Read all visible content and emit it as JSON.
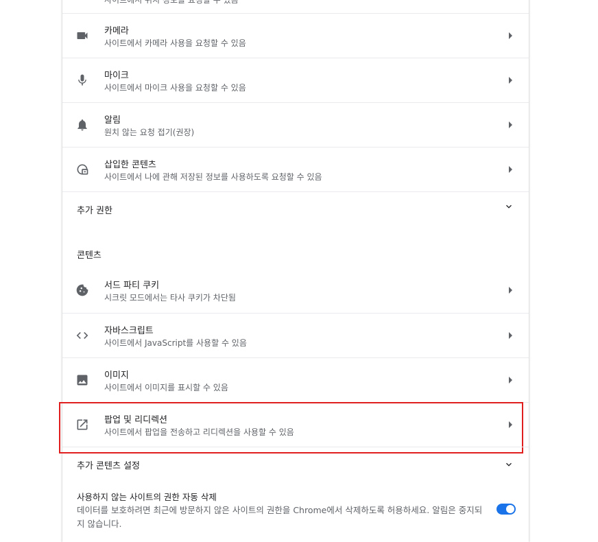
{
  "top_partial_text": "사이트에서 위치 정보를 요청할 수 있음",
  "permissions": [
    {
      "title": "카메라",
      "sub": "사이트에서 카메라 사용을 요청할 수 있음",
      "icon": "camera-icon"
    },
    {
      "title": "마이크",
      "sub": "사이트에서 마이크 사용을 요청할 수 있음",
      "icon": "microphone-icon"
    },
    {
      "title": "알림",
      "sub": "원치 않는 요청 접기(권장)",
      "icon": "bell-icon"
    },
    {
      "title": "삽입한 콘텐츠",
      "sub": "사이트에서 나에 관해 저장된 정보를 사용하도록 요청할 수 있음",
      "icon": "embedded-content-icon"
    }
  ],
  "additional_permissions_label": "추가 권한",
  "content_section_label": "콘텐츠",
  "content": [
    {
      "title": "서드 파티 쿠키",
      "sub": "시크릿 모드에서는 타사 쿠키가 차단됨",
      "icon": "cookie-icon"
    },
    {
      "title": "자바스크립트",
      "sub": "사이트에서 JavaScript를 사용할 수 있음",
      "icon": "code-icon"
    },
    {
      "title": "이미지",
      "sub": "사이트에서 이미지를 표시할 수 있음",
      "icon": "image-icon"
    },
    {
      "title": "팝업 및 리디렉션",
      "sub": "사이트에서 팝업을 전송하고 리디렉션을 사용할 수 있음",
      "icon": "open-in-new-icon"
    }
  ],
  "additional_content_label": "추가 콘텐츠 설정",
  "auto_revoke": {
    "title": "사용하지 않는 사이트의 권한 자동 삭제",
    "description": "데이터를 보호하려면 최근에 방문하지 않은 사이트의 권한을 Chrome에서 삭제하도록 허용하세요. 알림은 중지되지 않습니다.",
    "enabled": true
  },
  "colors": {
    "accent": "#1a73e8",
    "highlight": "#e01e1e"
  }
}
